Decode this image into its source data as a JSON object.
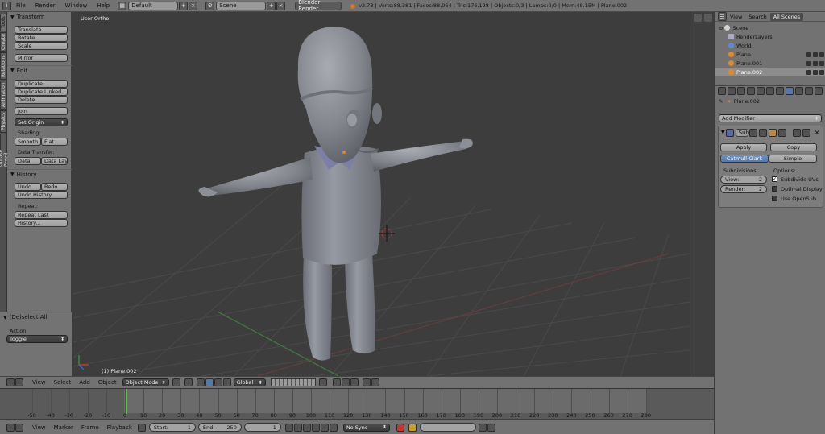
{
  "topbar": {
    "menus": [
      "File",
      "Render",
      "Window",
      "Help"
    ],
    "screen": "Default",
    "scene": "Scene",
    "engine": "Blender Render",
    "stats": "v2.78 | Verts:88,381 | Faces:88,064 | Tris:176,128 | Objects:0/3 | Lamps:0/0 | Mem:48.15M | Plane.002"
  },
  "vtabs": [
    "Tools",
    "Create",
    "Relations",
    "Animation",
    "Physics",
    "Grease Pencil"
  ],
  "toolshelf": {
    "transform": {
      "title": "Transform",
      "buttons": [
        "Translate",
        "Rotate",
        "Scale",
        "Mirror"
      ]
    },
    "edit": {
      "title": "Edit",
      "buttons": [
        "Duplicate",
        "Duplicate Linked",
        "Delete",
        "Join"
      ],
      "set_origin": "Set Origin",
      "shading_label": "Shading:",
      "smooth": "Smooth",
      "flat": "Flat",
      "data_transfer_label": "Data Transfer:",
      "data": "Data",
      "data_layout": "Data Layo"
    },
    "history": {
      "title": "History",
      "undo": "Undo",
      "redo": "Redo",
      "undo_history": "Undo History",
      "repeat_label": "Repeat:",
      "repeat_last": "Repeat Last",
      "history_btn": "History..."
    },
    "operator": {
      "title": "(De)select All",
      "action_label": "Action",
      "action_value": "Toggle"
    }
  },
  "viewport": {
    "view_label": "User Ortho",
    "object_label": "(1) Plane.002"
  },
  "outliner": {
    "tabs": [
      "View",
      "Search",
      "All Scenes"
    ],
    "items": [
      {
        "label": "Scene"
      },
      {
        "label": "RenderLayers"
      },
      {
        "label": "World"
      },
      {
        "label": "Plane"
      },
      {
        "label": "Plane.001"
      },
      {
        "label": "Plane.002"
      }
    ]
  },
  "properties": {
    "object_name": "Plane.002",
    "add_modifier": "Add Modifier",
    "modifier_short": "Sub",
    "apply": "Apply",
    "copy": "Copy",
    "catmull": "Catmull-Clark",
    "simple": "Simple",
    "subdivisions_label": "Subdivisions:",
    "view_label": "View:",
    "view_value": "2",
    "render_label": "Render:",
    "render_value": "2",
    "options_label": "Options:",
    "subdivide_uvs": "Subdivide UVs",
    "optimal_display": "Optimal Display",
    "use_opensubdiv": "Use OpenSub..."
  },
  "vp_header": {
    "menus": [
      "View",
      "Select",
      "Add",
      "Object"
    ],
    "mode": "Object Mode",
    "orientation": "Global"
  },
  "timeline": {
    "ticks": [
      -50,
      -40,
      -30,
      -20,
      -10,
      0,
      10,
      20,
      30,
      40,
      50,
      60,
      70,
      80,
      90,
      100,
      110,
      120,
      130,
      140,
      150,
      160,
      170,
      180,
      190,
      200,
      210,
      220,
      230,
      240,
      250,
      260,
      270,
      280
    ],
    "current_frame": 1
  },
  "tl_header": {
    "menus": [
      "View",
      "Marker",
      "Frame",
      "Playback"
    ],
    "start_label": "Start:",
    "start_value": "1",
    "end_label": "End:",
    "end_value": "250",
    "current_value": "1",
    "sync": "No Sync"
  },
  "colors": {
    "accent_blue": "#5479ad",
    "playhead": "#5bc04a",
    "mesh": "#8a8c93"
  }
}
